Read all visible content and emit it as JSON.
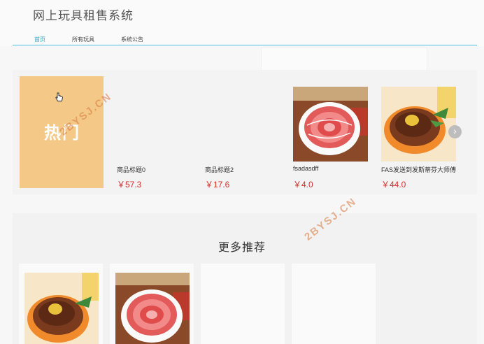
{
  "header": {
    "title": "网上玩具租售系统"
  },
  "nav": {
    "items": [
      {
        "label": "首页",
        "active": true
      },
      {
        "label": "所有玩具",
        "active": false
      },
      {
        "label": "系统公告",
        "active": false
      }
    ]
  },
  "hot": {
    "banner_text": "热门",
    "products": [
      {
        "name": "商品标题0",
        "price": "￥57.3",
        "image": "none"
      },
      {
        "name": "商品标题2",
        "price": "￥17.6",
        "image": "none"
      },
      {
        "name": "fsadasdff",
        "price": "￥4.0",
        "image": "ham-slices-plate"
      },
      {
        "name": "FAS发送到发斯蒂芬大师傅",
        "price": "￥44.0",
        "image": "braised-meat-dish"
      }
    ],
    "next_icon": "chevron-right-icon"
  },
  "more": {
    "title": "更多推荐",
    "items": [
      {
        "image": "braised-meat-dish"
      },
      {
        "image": "ham-slices-plate"
      },
      {
        "image": "none"
      },
      {
        "image": "none"
      }
    ]
  },
  "watermark": {
    "text": "2BYSJ.CN"
  },
  "colors": {
    "accent": "#2aa7c9",
    "price": "#d0312d",
    "hot_banner": "#f4c988"
  }
}
